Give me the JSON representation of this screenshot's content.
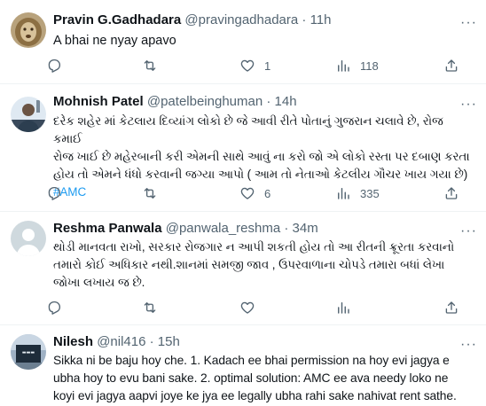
{
  "tweets": [
    {
      "name": "Pravin G.Gadhadara",
      "handle": "@pravingadhadara",
      "time": "11h",
      "lines": [
        "A bhai ne nyay apavo"
      ],
      "hashtag": "",
      "stats": {
        "replies": "",
        "retweets": "",
        "likes": "1",
        "views": "118"
      }
    },
    {
      "name": "Mohnish Patel",
      "handle": "@patelbeinghuman",
      "time": "14h",
      "lines": [
        "દરેક શહેર માં કેટલાય દિવ્યાંગ લોકો છે જે આવી રીતે પોતાનું ગુજરાન ચલાવે છે, રોજ કમાઈ",
        "રોજ ખાઈ છે મહેરબાની કરી એમની સાથે આવું ના કરો જો એ લોકો રસ્તા પર દબાણ કરતા",
        "હોય તો એમને ધંધો કરવાની જગ્યા આપો ( આમ તો નેતાઓ કેટલીય ગૌચર ખાય ગયા છે)"
      ],
      "hashtag": "#AMC",
      "stats": {
        "replies": "",
        "retweets": "",
        "likes": "6",
        "views": "335"
      }
    },
    {
      "name": "Reshma Panwala",
      "handle": "@panwala_reshma",
      "time": "34m",
      "lines": [
        "થોડી માનવતા રાખો, સરકાર રોજગાર ન આપી શકતી હોય તો આ રીતની ક્રૂરતા કરવાનો",
        "તમારો કોઈ અધિકાર નથી.શાનમાં સમજી જાવ , ઉપરવાળાના ચોપડે તમારા બધાં લેખા",
        "જોખા લખાય જ છે."
      ],
      "hashtag": "",
      "stats": {
        "replies": "",
        "retweets": "",
        "likes": "",
        "views": ""
      }
    },
    {
      "name": "Nilesh",
      "handle": "@nil416",
      "time": "15h",
      "lines": [
        "Sikka ni be baju hoy che. 1. Kadach ee bhai permission na hoy evi jagya e",
        "ubha hoy to evu bani sake. 2. optimal solution: AMC ee ava needy loko ne",
        "koyi evi jagya aapvi joye ke jya ee legally ubha rahi sake nahivat rent sathe."
      ],
      "hashtag": "",
      "stats": {
        "replies": "",
        "retweets": "",
        "likes": "",
        "views": ""
      }
    }
  ],
  "ui": {
    "separator": "·",
    "more_glyph": "···",
    "colors": {
      "text": "#0f1419",
      "muted": "#536471",
      "link": "#1d9bf0",
      "divider": "#eff3f4"
    }
  }
}
